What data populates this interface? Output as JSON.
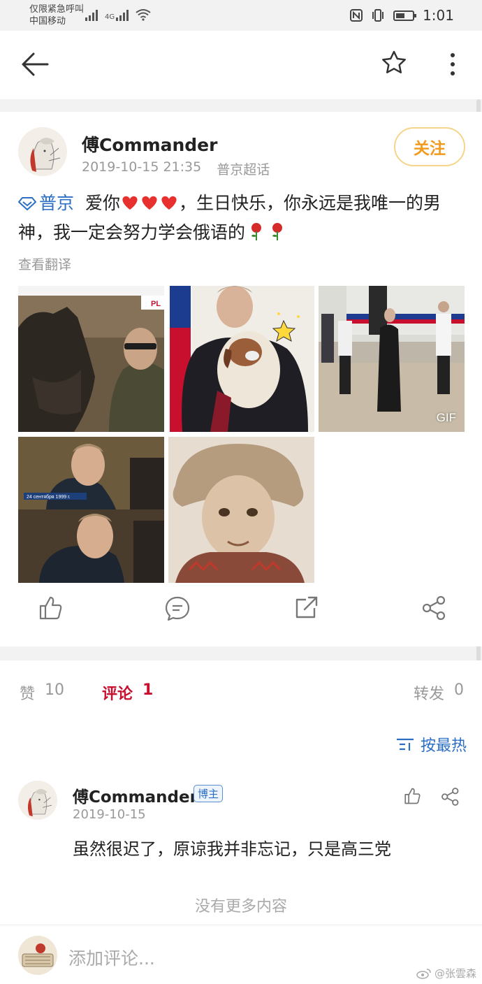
{
  "status_bar": {
    "carrier_line1": "仅限紧急呼叫",
    "carrier_line2": "中国移动",
    "network": "4G",
    "time": "1:01"
  },
  "post": {
    "author": "傅Commander",
    "date": "2019-10-15 21:35",
    "source": "普京超话",
    "follow_label": "关注",
    "topic": "普京",
    "text_before_hearts": "爱你",
    "text_after_hearts": "，生日快乐，你永远是我唯一的男神，我一定会努力学会俄语的",
    "translate_label": "查看翻译",
    "gif_label": "GIF",
    "image_captions": {
      "image1_logo": "PL",
      "image4_caption": "24 сентября 1999 г."
    }
  },
  "stats": {
    "like_label": "赞",
    "like_count": "10",
    "comment_label": "评论",
    "comment_count": "1",
    "forward_label": "转发",
    "forward_count": "0",
    "sort_label": "按最热"
  },
  "comment": {
    "author": "傅Commander",
    "badge": "博主",
    "date": "2019-10-15",
    "text": "虽然很迟了，原谅我并非忘记，只是高三党"
  },
  "no_more": "没有更多内容",
  "bottom_bar": {
    "input_placeholder": "添加评论...",
    "watermark": "@张雲森"
  },
  "colors": {
    "accent_orange": "#f29a1d",
    "link_blue": "#2b6fc4",
    "comment_red": "#c8102e",
    "heart_red": "#e8312f"
  }
}
